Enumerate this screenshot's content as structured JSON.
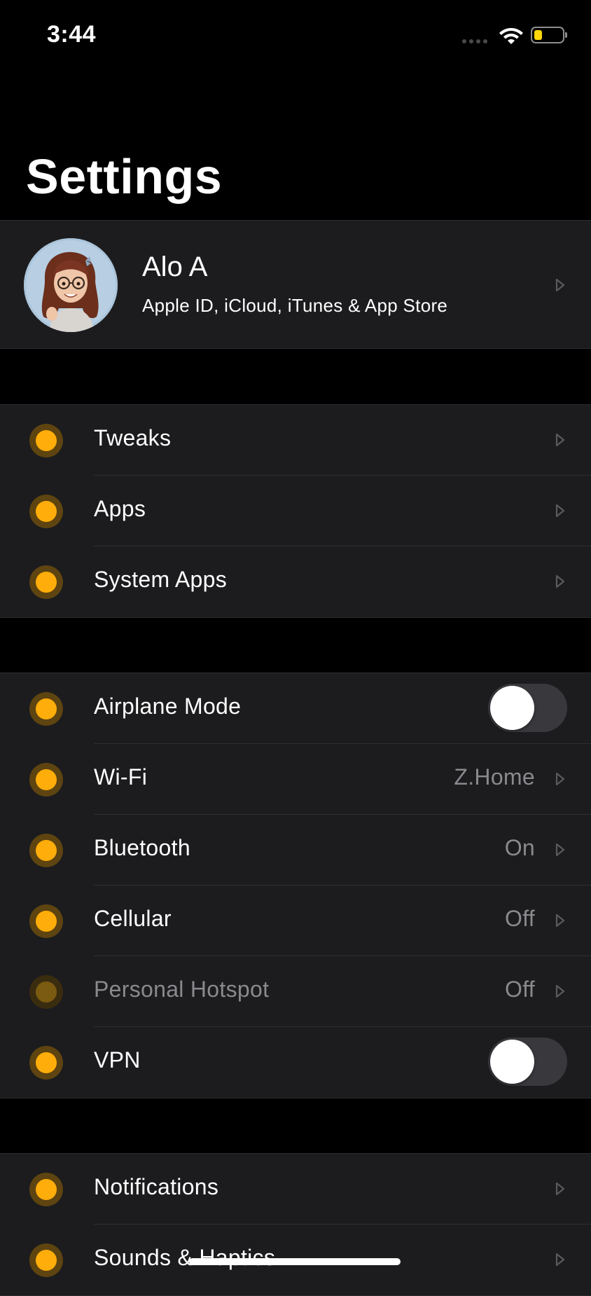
{
  "status_bar": {
    "time": "3:44",
    "battery_level": 0.3,
    "battery_color": "#ffd60a"
  },
  "page_title": "Settings",
  "profile": {
    "name": "Alo A",
    "subtitle": "Apple ID, iCloud, iTunes & App Store"
  },
  "groups": [
    {
      "rows": [
        {
          "label": "Tweaks",
          "icon": "tweaks-icon",
          "accessory": "chevron"
        },
        {
          "label": "Apps",
          "icon": "apps-icon",
          "accessory": "chevron"
        },
        {
          "label": "System Apps",
          "icon": "system-apps-icon",
          "accessory": "chevron"
        }
      ]
    },
    {
      "rows": [
        {
          "label": "Airplane Mode",
          "icon": "airplane-icon",
          "accessory": "toggle",
          "toggle_on": false
        },
        {
          "label": "Wi-Fi",
          "icon": "wifi-icon",
          "value": "Z.Home",
          "accessory": "chevron"
        },
        {
          "label": "Bluetooth",
          "icon": "bluetooth-icon",
          "value": "On",
          "accessory": "chevron"
        },
        {
          "label": "Cellular",
          "icon": "cellular-icon",
          "value": "Off",
          "accessory": "chevron"
        },
        {
          "label": "Personal Hotspot",
          "icon": "hotspot-icon",
          "value": "Off",
          "accessory": "chevron",
          "disabled": true
        },
        {
          "label": "VPN",
          "icon": "vpn-icon",
          "accessory": "toggle",
          "toggle_on": false
        }
      ]
    },
    {
      "rows": [
        {
          "label": "Notifications",
          "icon": "notifications-icon",
          "accessory": "chevron"
        },
        {
          "label": "Sounds & Haptics",
          "icon": "sounds-icon",
          "accessory": "chevron"
        }
      ]
    }
  ],
  "colors": {
    "icon_accent": "#ffad0a",
    "background": "#000000",
    "cell_background": "#1c1c1e",
    "secondary_text": "#8a8a8e"
  }
}
